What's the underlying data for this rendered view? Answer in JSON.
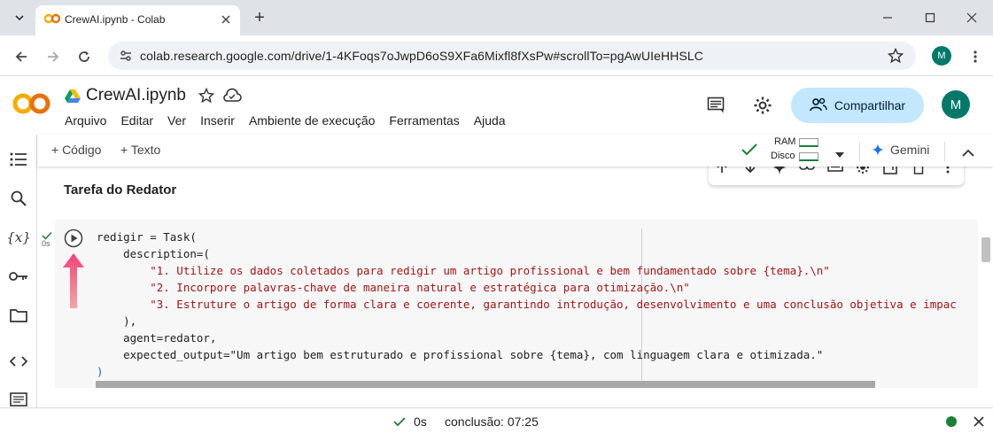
{
  "browser": {
    "tab_title": "CrewAI.ipynb - Colab",
    "url": "colab.research.google.com/drive/1-4KFoqs7oJwpD6oS9XFa6Mixfl8fXsPw#scrollTo=pgAwUIeHHSLC",
    "profile_initial": "M"
  },
  "colab": {
    "notebook_title": "CrewAI.ipynb",
    "menu": [
      "Arquivo",
      "Editar",
      "Ver",
      "Inserir",
      "Ambiente de execução",
      "Ferramentas",
      "Ajuda"
    ],
    "share_label": "Compartilhar",
    "avatar_initial": "M"
  },
  "toolbar": {
    "add_code": "+ Código",
    "add_text": "+ Texto",
    "ram_label": "RAM",
    "disk_label": "Disco",
    "gemini_label": "Gemini"
  },
  "cell": {
    "heading": "Tarefa do Redator",
    "exec_time": "0s",
    "code_lines": [
      "redigir = Task(",
      "    description=(",
      "        \"1. Utilize os dados coletados para redigir um artigo profissional e bem fundamentado sobre {tema}.\\n\"",
      "        \"2. Incorpore palavras-chave de maneira natural e estratégica para otimização.\\n\"",
      "        \"3. Estruture o artigo de forma clara e coerente, garantindo introdução, desenvolvimento e uma conclusão objetiva e impac",
      "    ),",
      "    agent=redator,",
      "    expected_output=\"Um artigo bem estruturado e profissional sobre {tema}, com linguagem clara e otimizada.\"",
      ")"
    ]
  },
  "status": {
    "exec_time": "0s",
    "completion": "conclusão: 07:25"
  },
  "colors": {
    "accent": "#1a73e8",
    "share_bg": "#c2e7ff",
    "string": "#a31515",
    "status_ok": "#188038"
  }
}
